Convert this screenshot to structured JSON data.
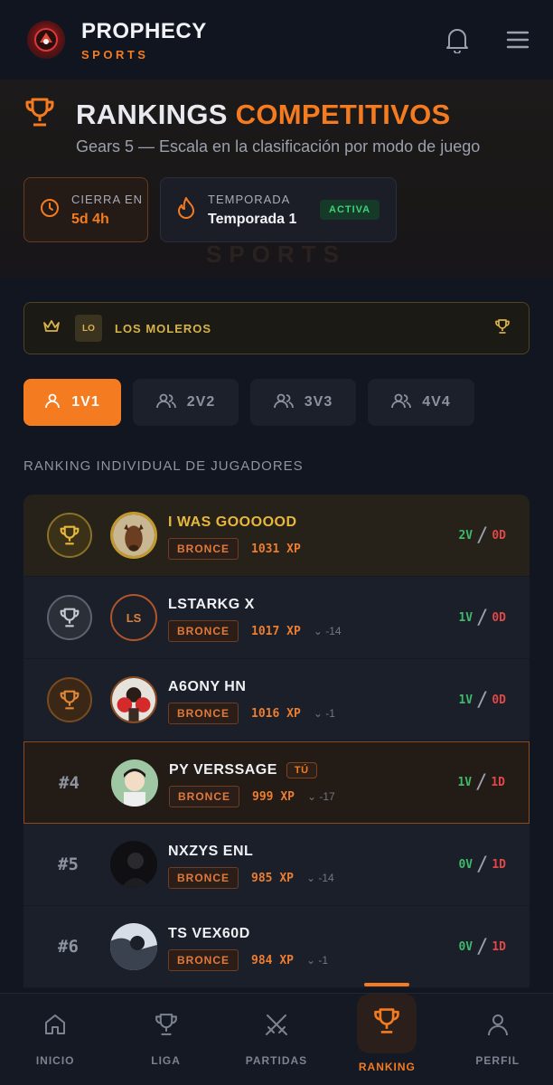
{
  "header": {
    "brand_name": "PROPHECY",
    "brand_sub": "SPORTS",
    "notification_icon": "bell-icon",
    "menu_icon": "hamburger-menu-icon"
  },
  "hero": {
    "title_main": "RANKINGS",
    "title_accent": "COMPETITIVOS",
    "subtitle": "Gears 5 — Escala en la clasificación por modo de juego",
    "watermark": "SPORTS",
    "close": {
      "label": "CIERRA EN",
      "value": "5d 4h"
    },
    "season": {
      "label": "TEMPORADA",
      "value": "Temporada 1",
      "status": "ACTIVA"
    }
  },
  "team": {
    "abbr": "LO",
    "name": "LOS MOLEROS"
  },
  "tabs": [
    {
      "label": "1V1",
      "active": true
    },
    {
      "label": "2V2",
      "active": false
    },
    {
      "label": "3V3",
      "active": false
    },
    {
      "label": "4V4",
      "active": false
    }
  ],
  "section_label": "RANKING INDIVIDUAL DE JUGADORES",
  "players": [
    {
      "rank": "1",
      "name": "I WAS GOOOOOD",
      "tier": "BRONCE",
      "xp": "1031 XP",
      "delta": "",
      "wins": "2V",
      "losses": "0D"
    },
    {
      "rank": "2",
      "name": "LSTARKG X",
      "initials": "LS",
      "tier": "BRONCE",
      "xp": "1017 XP",
      "delta": "-14",
      "wins": "1V",
      "losses": "0D"
    },
    {
      "rank": "3",
      "name": "A6ONY HN",
      "tier": "BRONCE",
      "xp": "1016 XP",
      "delta": "-1",
      "wins": "1V",
      "losses": "0D"
    },
    {
      "rank": "#4",
      "name": "PY VERSSAGE",
      "you": "TÚ",
      "tier": "BRONCE",
      "xp": "999 XP",
      "delta": "-17",
      "wins": "1V",
      "losses": "1D"
    },
    {
      "rank": "#5",
      "name": "NXZYS ENL",
      "tier": "BRONCE",
      "xp": "985 XP",
      "delta": "-14",
      "wins": "0V",
      "losses": "1D"
    },
    {
      "rank": "#6",
      "name": "TS VEX60D",
      "tier": "BRONCE",
      "xp": "984 XP",
      "delta": "-1",
      "wins": "0V",
      "losses": "1D"
    }
  ],
  "nav": [
    {
      "label": "INICIO",
      "icon": "home-icon"
    },
    {
      "label": "LIGA",
      "icon": "trophy-icon"
    },
    {
      "label": "PARTIDAS",
      "icon": "crossed-swords-icon"
    },
    {
      "label": "RANKING",
      "icon": "trophy-icon",
      "active": true
    },
    {
      "label": "PERFIL",
      "icon": "user-icon"
    }
  ],
  "colors": {
    "accent": "#f47b20",
    "gold": "#e9b73c",
    "win": "#3fb96a",
    "loss": "#e04848",
    "background": "#121620"
  }
}
